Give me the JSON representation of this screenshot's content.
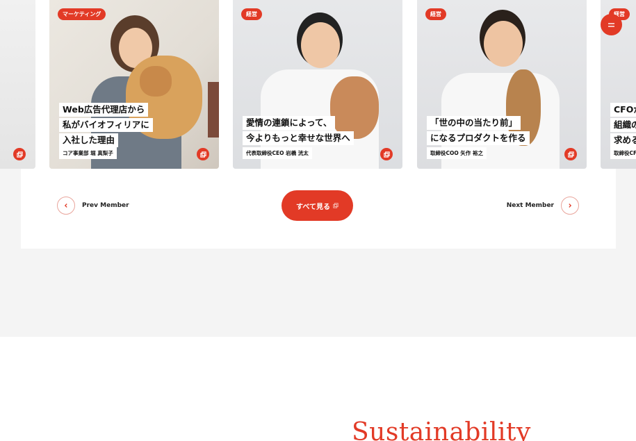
{
  "cards": [
    {
      "tag": "マーケティング",
      "title_lines": [
        "Web広告代理店から",
        "私がバイオフィリアに",
        "入社した理由"
      ],
      "name": "コア事業部 堀 真梨子"
    },
    {
      "tag": "経営",
      "title_lines": [
        "愛情の連鎖によって、",
        "今よりもっと幸せな世界へ"
      ],
      "name": "代表取締役CEO 岩橋 洸太"
    },
    {
      "tag": "経営",
      "title_lines": [
        "「世の中の当たり前」",
        "になるプロダクトを作る"
      ],
      "name": "取締役COO 矢作 裕之"
    },
    {
      "tag": "経営",
      "title_lines": [
        "CFOが",
        "組織の",
        "求める"
      ],
      "name": "取締役CF"
    }
  ],
  "nav": {
    "prev_label": "Prev Member",
    "next_label": "Next Member",
    "see_all_label": "すべて見る"
  },
  "section_heading": "Sustainability",
  "colors": {
    "accent": "#e23a26",
    "background": "#f4f4f4"
  }
}
